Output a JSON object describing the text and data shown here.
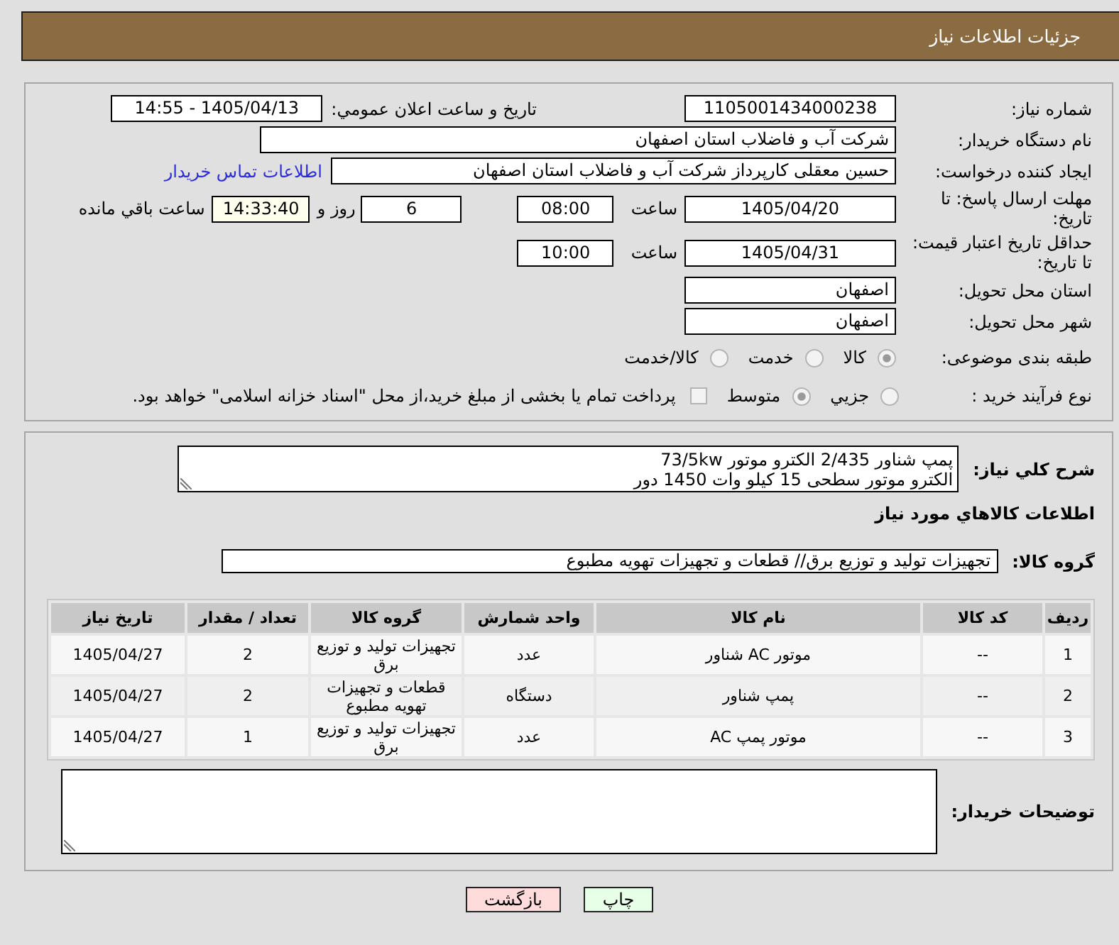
{
  "header": {
    "title": "جزئیات اطلاعات نیاز"
  },
  "details": {
    "need_number": {
      "label": "شماره نیاز:",
      "value": "1105001434000238"
    },
    "announcement": {
      "label": "تاریخ و ساعت اعلان عمومي:",
      "value": "1405/04/13 - 14:55"
    },
    "buyer_org": {
      "label": "نام دستگاه خریدار:",
      "value": "شرکت آب و فاضلاب استان اصفهان"
    },
    "requester": {
      "label": "ایجاد کننده درخواست:",
      "value": "حسین معقلی کارپرداز شرکت آب و فاضلاب استان اصفهان",
      "contact_link": "اطلاعات تماس خریدار"
    },
    "response_deadline": {
      "label": "مهلت ارسال پاسخ: تا تاریخ:",
      "date": "1405/04/20",
      "time_label": "ساعت",
      "time": "08:00",
      "days": "6",
      "days_label": "روز و",
      "remaining": "14:33:40",
      "remaining_label": "ساعت باقي مانده"
    },
    "price_validity": {
      "label": "حداقل تاریخ اعتبار قیمت: تا تاریخ:",
      "date": "1405/04/31",
      "time_label": "ساعت",
      "time": "10:00"
    },
    "delivery_province": {
      "label": "استان محل تحویل:",
      "value": "اصفهان"
    },
    "delivery_city": {
      "label": "شهر محل تحویل:",
      "value": "اصفهان"
    },
    "category": {
      "label": "طبقه بندی موضوعی:",
      "options": [
        {
          "label": "کالا",
          "selected": true
        },
        {
          "label": "خدمت",
          "selected": false
        },
        {
          "label": "کالا/خدمت",
          "selected": false
        }
      ]
    },
    "purchase_process": {
      "label": "نوع فرآیند خرید :",
      "options": [
        {
          "label": "جزيي",
          "selected": false
        },
        {
          "label": "متوسط",
          "selected": true
        }
      ],
      "treasury_payment": {
        "label": "پرداخت تمام یا بخشی از مبلغ خرید،از محل \"اسناد خزانه اسلامی\" خواهد بود.",
        "checked": false
      }
    }
  },
  "items_section": {
    "summary": {
      "label": "شرح کلي نیاز:",
      "value": "پمپ شناور 2/435 الکترو موتور 73/5kw\nالکترو موتور سطحی 15 کیلو وات 1450 دور"
    },
    "heading": "اطلاعات کالاهاي مورد نیاز",
    "product_group": {
      "label": "گروه کالا:",
      "value": "تجهیزات تولید و توزیع برق//  قطعات و تجهیزات تهویه مطبوع"
    },
    "table": {
      "columns": [
        "ردیف",
        "کد کالا",
        "نام کالا",
        "واحد شمارش",
        "گروه کالا",
        "تعداد / مقدار",
        "تاریخ نیاز"
      ],
      "rows": [
        {
          "row": "1",
          "code": "--",
          "name": "موتور AC شناور",
          "unit": "عدد",
          "group": "تجهیزات تولید و توزیع برق",
          "quantity": "2",
          "need_date": "1405/04/27"
        },
        {
          "row": "2",
          "code": "--",
          "name": "پمپ شناور",
          "unit": "دستگاه",
          "group": "قطعات و تجهیزات تهویه مطبوع",
          "quantity": "2",
          "need_date": "1405/04/27"
        },
        {
          "row": "3",
          "code": "--",
          "name": "موتور پمپ AC",
          "unit": "عدد",
          "group": "تجهیزات تولید و توزیع برق",
          "quantity": "1",
          "need_date": "1405/04/27"
        }
      ]
    },
    "buyer_notes": {
      "label": "توضیحات خریدار:"
    }
  },
  "buttons": [
    {
      "label": "چاپ",
      "kind": "print"
    },
    {
      "label": "بازگشت",
      "kind": "back"
    }
  ]
}
